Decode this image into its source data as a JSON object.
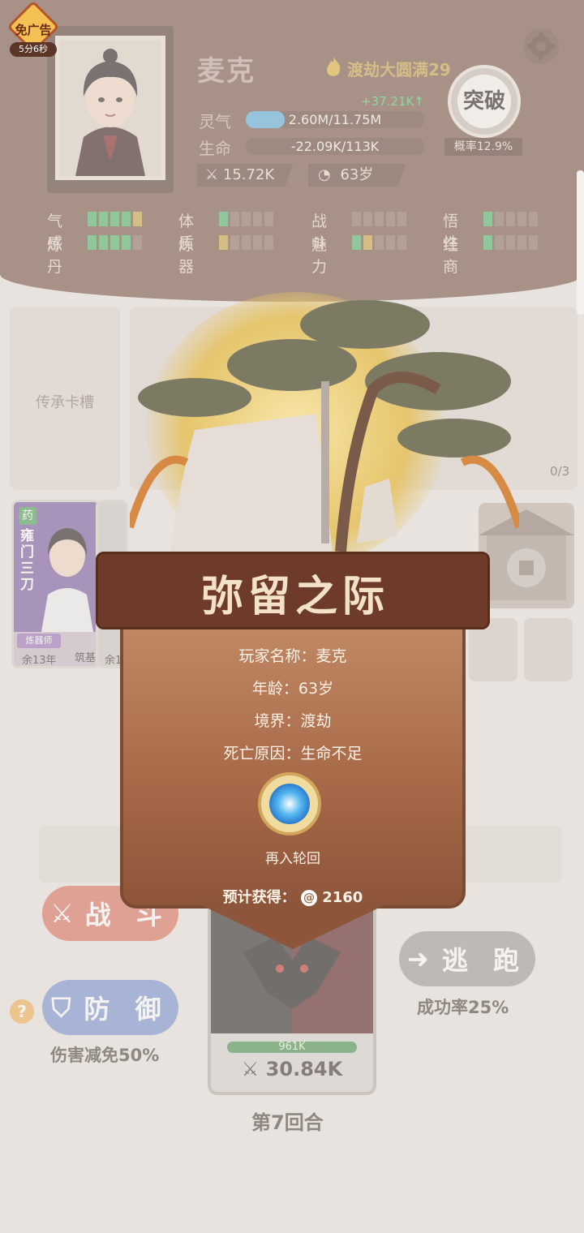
{
  "header": {
    "ad_badge": {
      "label": "免广告",
      "timer": "5分6秒"
    },
    "player_name": "麦克",
    "realm": "渡劫大圆满29",
    "qi_gain": "+37.21K↑",
    "stats": {
      "qi": {
        "label": "灵气",
        "value": "2.60M/11.75M",
        "fraction": 0.22,
        "color": "#5aaedb"
      },
      "hp": {
        "label": "生命",
        "value": "-22.09K/113K",
        "fraction": 0.0,
        "color": "#c8524a"
      }
    },
    "power": "15.72K",
    "age": "63岁",
    "breakthrough": {
      "label": "突破",
      "probability": "概率12.9%"
    },
    "attributes": [
      {
        "label": "气感",
        "level": 5,
        "top_gold": true
      },
      {
        "label": "体质",
        "level": 1,
        "top_gold": false
      },
      {
        "label": "战斗",
        "level": 0,
        "top_gold": false
      },
      {
        "label": "悟性",
        "level": 1,
        "top_gold": false
      },
      {
        "label": "炼丹",
        "level": 4,
        "top_gold": false
      },
      {
        "label": "炼器",
        "level": 1,
        "top_gold": true
      },
      {
        "label": "魅力",
        "level": 2,
        "top_gold": true
      },
      {
        "label": "经商",
        "level": 1,
        "top_gold": false
      }
    ]
  },
  "slots": {
    "inherit_label": "传承卡槽",
    "count": "0/3"
  },
  "cards": [
    {
      "badge": "药",
      "name": "雍门三刀",
      "role": "炼器师",
      "years": "余13年",
      "extra": "筑基"
    },
    {
      "years": "余1"
    }
  ],
  "battle": {
    "fight_label": "战 斗",
    "defend_label": "防 御",
    "defend_note": "伤害减免50%",
    "flee_label": "逃 跑",
    "flee_note": "成功率25%",
    "help": "?",
    "enemy_hp": "961K",
    "enemy_atk": "30.84K",
    "round": "第7回合"
  },
  "modal": {
    "title": "弥留之际",
    "player_name": "玩家名称：麦克",
    "age": "年龄：63岁",
    "realm": "境界：渡劫",
    "death_cause": "死亡原因：生命不足",
    "reincarnate": "再入轮回",
    "reward_label": "预计获得：",
    "reward_value": "2160"
  }
}
